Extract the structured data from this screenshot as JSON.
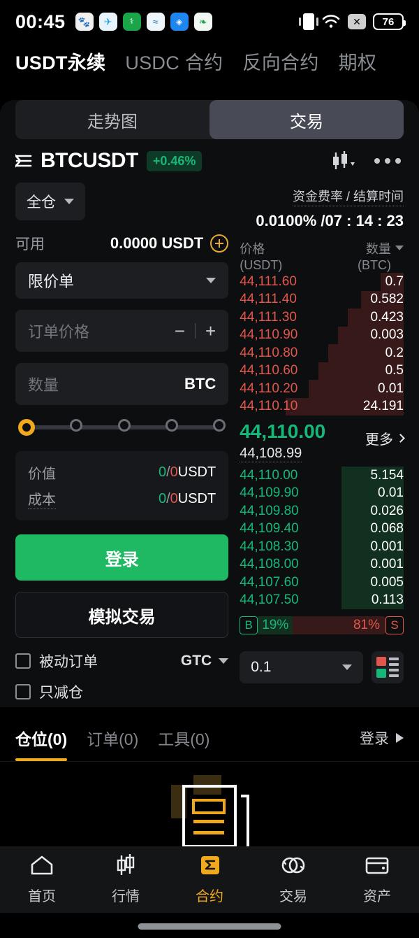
{
  "statusbar": {
    "time": "00:45",
    "battery": "76",
    "app_icons": [
      "baidu-paw-icon",
      "telegram-icon",
      "green-app-icon",
      "wave-app-icon",
      "shield-app-icon",
      "leaf-app-icon"
    ],
    "right_icons": [
      "vibrate-icon",
      "wifi-icon",
      "signal-off-icon",
      "battery-icon"
    ]
  },
  "top_tabs": [
    {
      "label": "USDT永续",
      "active": true
    },
    {
      "label": "USDC 合约",
      "active": false
    },
    {
      "label": "反向合约",
      "active": false
    },
    {
      "label": "期权",
      "active": false
    }
  ],
  "segment": [
    {
      "label": "走势图",
      "active": false
    },
    {
      "label": "交易",
      "active": true
    }
  ],
  "symbol": {
    "name": "BTCUSDT",
    "change": "+0.46%",
    "change_color": "#17b877"
  },
  "order_form": {
    "margin_mode": "全仓",
    "available_label": "可用",
    "available_value": "0.0000 USDT",
    "order_type": "限价单",
    "price_placeholder": "订单价格",
    "minus": "−",
    "plus": "+",
    "qty_placeholder": "数量",
    "qty_unit": "BTC",
    "slider_percent": 0,
    "slider_nodes": 5,
    "value_label": "价值",
    "value_amount_green": "0",
    "value_amount_sep": "/",
    "value_amount_red": "0",
    "value_unit": "USDT",
    "cost_label": "成本",
    "cost_amount_green": "0",
    "cost_amount_sep": "/",
    "cost_amount_red": "0",
    "cost_unit": "USDT",
    "login_button": "登录",
    "demo_button": "模拟交易",
    "post_only": "被动订单",
    "reduce_only": "只减仓",
    "tif": "GTC"
  },
  "funding": {
    "label": "资金费率 / 结算时间",
    "value": "0.0100% /07 : 14 : 23"
  },
  "orderbook": {
    "price_header": "价格",
    "price_header_unit": "(USDT)",
    "qty_header": "数量",
    "qty_header_unit": "(BTC)",
    "asks": [
      {
        "price": "44,111.60",
        "qty": "0.7",
        "depth": 14
      },
      {
        "price": "44,111.40",
        "qty": "0.582",
        "depth": 26
      },
      {
        "price": "44,111.30",
        "qty": "0.423",
        "depth": 34
      },
      {
        "price": "44,110.90",
        "qty": "0.003",
        "depth": 40
      },
      {
        "price": "44,110.80",
        "qty": "0.2",
        "depth": 46
      },
      {
        "price": "44,110.60",
        "qty": "0.5",
        "depth": 52
      },
      {
        "price": "44,110.20",
        "qty": "0.01",
        "depth": 58
      },
      {
        "price": "44,110.10",
        "qty": "24.191",
        "depth": 72
      }
    ],
    "mid_price": "44,110.00",
    "index_price": "44,108.99",
    "more_label": "更多",
    "bids": [
      {
        "price": "44,110.00",
        "qty": "5.154",
        "depth": 38
      },
      {
        "price": "44,109.90",
        "qty": "0.01",
        "depth": 38
      },
      {
        "price": "44,109.80",
        "qty": "0.026",
        "depth": 38
      },
      {
        "price": "44,109.40",
        "qty": "0.068",
        "depth": 38
      },
      {
        "price": "44,108.30",
        "qty": "0.001",
        "depth": 38
      },
      {
        "price": "44,108.00",
        "qty": "0.001",
        "depth": 38
      },
      {
        "price": "44,107.60",
        "qty": "0.005",
        "depth": 38
      },
      {
        "price": "44,107.50",
        "qty": "0.113",
        "depth": 38
      }
    ],
    "buy_tag": "B",
    "buy_ratio": "19%",
    "sell_ratio": "81%",
    "sell_tag": "S",
    "buy_ratio_num": 19,
    "sell_ratio_num": 81,
    "tick_size": "0.1"
  },
  "section_tabs": [
    {
      "label": "仓位(0)",
      "active": true
    },
    {
      "label": "订单(0)",
      "active": false
    },
    {
      "label": "工具(0)",
      "active": false
    }
  ],
  "section_login": "登录",
  "bottom_nav": [
    {
      "label": "首页",
      "icon": "home-icon",
      "active": false
    },
    {
      "label": "行情",
      "icon": "candles-icon",
      "active": false
    },
    {
      "label": "合约",
      "icon": "contract-icon",
      "active": true
    },
    {
      "label": "交易",
      "icon": "swap-icon",
      "active": false
    },
    {
      "label": "资产",
      "icon": "wallet-icon",
      "active": false
    }
  ],
  "colors": {
    "accent": "#f0a81d",
    "up": "#16b87a",
    "down": "#e2574c",
    "login_green": "#1fb863",
    "background": "#000000",
    "panel": "#0d0e10"
  }
}
